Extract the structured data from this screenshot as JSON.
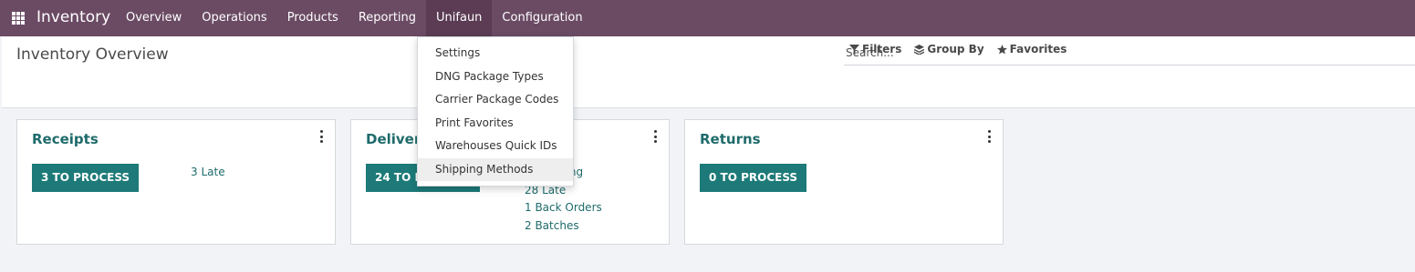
{
  "app": {
    "title": "Inventory"
  },
  "navbar": {
    "menu": [
      {
        "label": "Overview"
      },
      {
        "label": "Operations"
      },
      {
        "label": "Products"
      },
      {
        "label": "Reporting"
      },
      {
        "label": "Unifaun"
      },
      {
        "label": "Configuration"
      }
    ],
    "active": "Unifaun",
    "color": "#6b4b64"
  },
  "control_panel": {
    "title": "Inventory Overview",
    "search": {
      "placeholder": "Search..."
    },
    "filters_label": "Filters",
    "group_by_label": "Group By",
    "favorites_label": "Favorites"
  },
  "cards": [
    {
      "title": "Receipts",
      "button": "3 TO PROCESS",
      "stats": [
        "3 Late"
      ]
    },
    {
      "title": "Delivery Orders",
      "button": "24 TO PROCESS",
      "stats": [
        "28 Waiting",
        "28 Late",
        "1 Back Orders",
        "2 Batches"
      ]
    },
    {
      "title": "Returns",
      "button": "0 TO PROCESS",
      "stats": []
    }
  ],
  "dropdown": {
    "items": [
      {
        "label": "Settings"
      },
      {
        "label": "DNG Package Types"
      },
      {
        "label": "Carrier Package Codes"
      },
      {
        "label": "Print Favorites"
      },
      {
        "label": "Warehouses Quick IDs"
      },
      {
        "label": "Shipping Methods"
      }
    ],
    "highlighted": "Shipping Methods"
  },
  "colors": {
    "accent": "#1d7a78",
    "link": "#1f6b6b"
  }
}
